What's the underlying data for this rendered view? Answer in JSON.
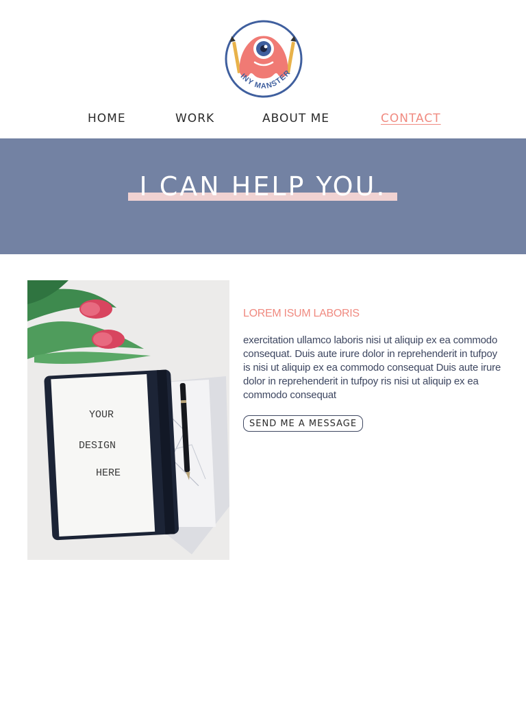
{
  "brand": {
    "logo_text": "TINY MANSTER"
  },
  "nav": {
    "items": [
      {
        "label": "HOME"
      },
      {
        "label": "WORK"
      },
      {
        "label": "ABOUT ME"
      },
      {
        "label": "CONTACT",
        "active": true
      }
    ]
  },
  "hero": {
    "title": "I CAN HELP YOU."
  },
  "main": {
    "image": {
      "notebook_text": [
        "YOUR",
        "DESIGN",
        "HERE"
      ]
    },
    "heading": "LOREM ISUM LABORIS",
    "body": "exercitation ullamco laboris nisi ut aliquip ex ea commodo consequat. Duis aute irure dolor in reprehenderit in tufpoy is nisi ut aliquip ex ea commodo consequat Duis aute irure dolor in reprehenderit in tufpoy ris nisi ut aliquip ex ea commodo consequat",
    "cta_label": "SEND ME A MESSAGE"
  },
  "colors": {
    "accent": "#f08a80",
    "hero_bg": "#7382a3",
    "highlight": "#f0d2d2",
    "text_dark": "#3d4660"
  }
}
